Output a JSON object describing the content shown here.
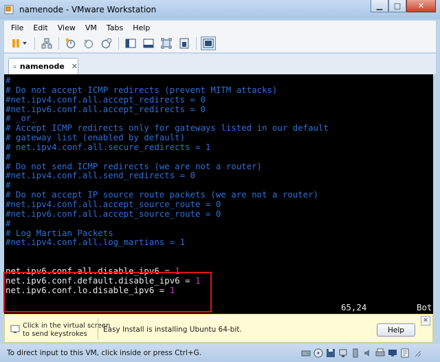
{
  "window": {
    "title": "namenode - VMware Workstation"
  },
  "menubar": {
    "items": [
      "File",
      "Edit",
      "View",
      "VM",
      "Tabs",
      "Help"
    ]
  },
  "tab": {
    "label": "namenode"
  },
  "terminal": {
    "lines": [
      "#",
      "# Do not accept ICMP redirects (prevent MITM attacks)",
      "#net.ipv4.conf.all.accept_redirects = 0",
      "#net.ipv6.conf.all.accept_redirects = 0",
      "# _or_",
      "# Accept ICMP redirects only for gateways listed in our default",
      "# gateway list (enabled by default)",
      "# net.ipv4.conf.all.secure_redirects = 1",
      "#",
      "# Do not send ICMP redirects (we are not a router)",
      "#net.ipv4.conf.all.send_redirects = 0",
      "#",
      "# Do not accept IP source route packets (we are not a router)",
      "#net.ipv4.conf.all.accept_source_route = 0",
      "#net.ipv6.conf.all.accept_source_route = 0",
      "#",
      "# Log Martian Packets",
      "#net.ipv4.conf.all.log_martians = 1",
      "",
      "",
      "net.ipv6.conf.all.disable_ipv6 = 1",
      "net.ipv6.conf.default.disable_ipv6 = 1",
      "net.ipv6.conf.lo.disable_ipv6 = 1"
    ],
    "cursor_position": "65,24",
    "scroll_indicator": "Bot"
  },
  "hint": {
    "left_text_1": "Click in the virtual screen",
    "left_text_2": "to send keystrokes",
    "main_text": "Easy Install is installing Ubuntu 64-bit.",
    "help_label": "Help"
  },
  "statusbar": {
    "text": "To direct input to this VM, click inside or press Ctrl+G."
  },
  "colors": {
    "comment": "#2f6fd6",
    "value": "#d23ac0",
    "highlight": "#e01414",
    "hint_bg": "#fffbd4"
  }
}
